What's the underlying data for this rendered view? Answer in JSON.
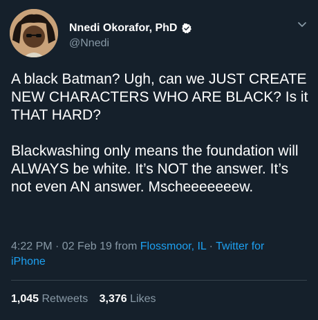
{
  "author": {
    "name": "Nnedi Okorafor, PhD",
    "handle": "@Nnedi"
  },
  "icons": {
    "verified": "verified-badge-icon",
    "menu": "chevron-down-icon"
  },
  "tweet": {
    "paragraph_1": "A black Batman? Ugh, can we JUST CREATE NEW CHARACTERS WHO ARE BLACK? Is it THAT HARD?",
    "paragraph_2": "Blackwashing only means the foundation will ALWAYS be white. It’s NOT the answer. It’s not even AN answer. Mscheeeeeeew."
  },
  "meta": {
    "timestamp": "4:22 PM · 02 Feb 19 from",
    "location": "Flossmoor, IL",
    "separator": "·",
    "source": "Twitter for iPhone"
  },
  "stats": {
    "retweets_count": "1,045",
    "retweets_label": "Retweets",
    "likes_count": "3,376",
    "likes_label": "Likes"
  },
  "colors": {
    "background": "#15202b",
    "link": "#1da1f2",
    "muted": "#8899a6"
  }
}
